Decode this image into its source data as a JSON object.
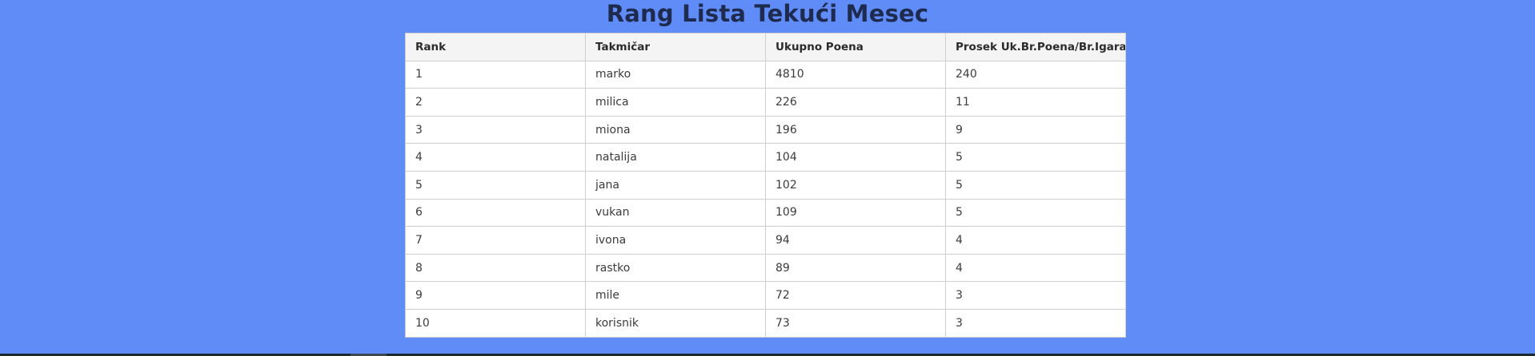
{
  "page": {
    "title": "Rang Lista Tekući Mesec",
    "colors": {
      "background": "#5f8cf7",
      "title": "#1f2a4f",
      "table_header_bg": "#f4f4f4",
      "table_border": "#cfcfcf"
    }
  },
  "table": {
    "headers": [
      "Rank",
      "Takmičar",
      "Ukupno Poena",
      "Prosek Uk.Br.Poena/Br.Igara"
    ],
    "rows": [
      [
        "1",
        "marko",
        "4810",
        "240"
      ],
      [
        "2",
        "milica",
        "226",
        "11"
      ],
      [
        "3",
        "miona",
        "196",
        "9"
      ],
      [
        "4",
        "natalija",
        "104",
        "5"
      ],
      [
        "5",
        "jana",
        "102",
        "5"
      ],
      [
        "6",
        "vukan",
        "109",
        "5"
      ],
      [
        "7",
        "ivona",
        "94",
        "4"
      ],
      [
        "8",
        "rastko",
        "89",
        "4"
      ],
      [
        "9",
        "mile",
        "72",
        "3"
      ],
      [
        "10",
        "korisnik",
        "73",
        "3"
      ]
    ]
  }
}
